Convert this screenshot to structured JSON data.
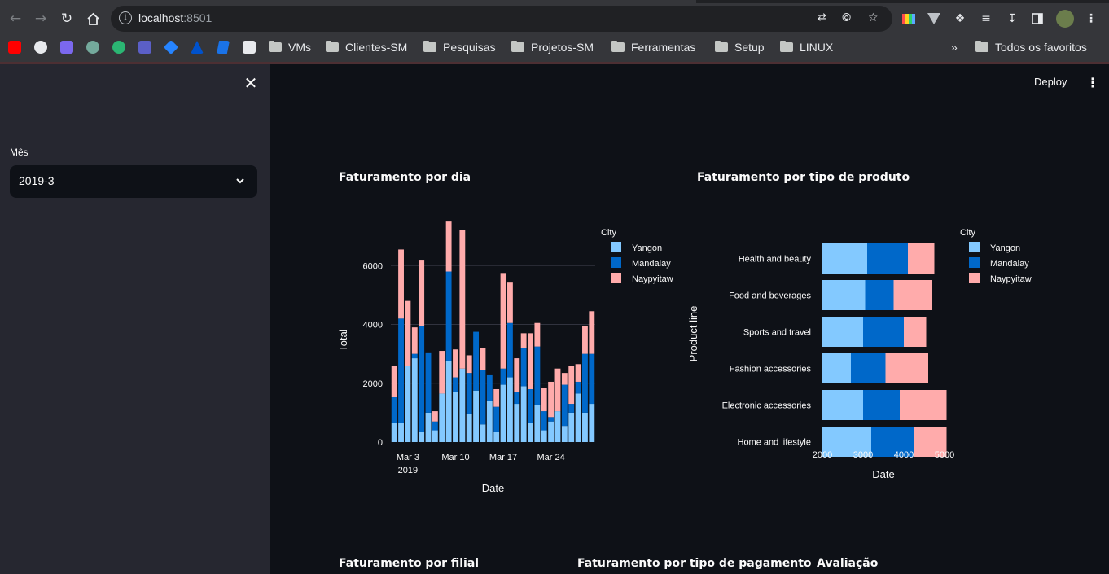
{
  "browser": {
    "url_host": "localhost",
    "url_port": ":8501",
    "bookmarks": [
      "VMs",
      "Clientes-SM",
      "Pesquisas",
      "Projetos-SM",
      "Ferramentas",
      "Setup",
      "LINUX"
    ],
    "all_bookmarks": "Todos os favoritos",
    "overflow": "»"
  },
  "sidebar": {
    "month_label": "Mês",
    "month_value": "2019-3"
  },
  "header": {
    "deploy": "Deploy",
    "menu_icon": "⋮"
  },
  "sections": {
    "daily": "Faturamento por dia",
    "product": "Faturamento por tipo de produto",
    "branch": "Faturamento por filial",
    "payment": "Faturamento por tipo de pagamento",
    "rating": "Avaliação"
  },
  "colors": {
    "yangon": "#83c9ff",
    "mandalay": "#0068c9",
    "naypyitaw": "#ffabab"
  },
  "chart_data": [
    {
      "type": "bar",
      "stacked": true,
      "xlabel": "Date",
      "ylabel": "Total",
      "ylim": [
        0,
        7500
      ],
      "yticks": [
        0,
        2000,
        4000,
        6000
      ],
      "xticks": [
        "Mar 3",
        "Mar 10",
        "Mar 17",
        "Mar 24"
      ],
      "xtick_year": "2019",
      "legend_title": "City",
      "categories": [
        "2019-03-01",
        "2019-03-02",
        "2019-03-03",
        "2019-03-04",
        "2019-03-05",
        "2019-03-06",
        "2019-03-07",
        "2019-03-08",
        "2019-03-09",
        "2019-03-10",
        "2019-03-11",
        "2019-03-12",
        "2019-03-13",
        "2019-03-14",
        "2019-03-15",
        "2019-03-16",
        "2019-03-17",
        "2019-03-18",
        "2019-03-19",
        "2019-03-20",
        "2019-03-21",
        "2019-03-22",
        "2019-03-23",
        "2019-03-24",
        "2019-03-25",
        "2019-03-26",
        "2019-03-27",
        "2019-03-28",
        "2019-03-29",
        "2019-03-30"
      ],
      "series": [
        {
          "name": "Yangon",
          "values": [
            650,
            650,
            2600,
            2850,
            350,
            1000,
            400,
            1650,
            2750,
            1700,
            2500,
            950,
            1750,
            600,
            1400,
            350,
            1950,
            2200,
            1300,
            1900,
            650,
            1250,
            400,
            700,
            1050,
            550,
            1000,
            1650,
            1000,
            1300
          ]
        },
        {
          "name": "Mandalay",
          "values": [
            900,
            3550,
            0,
            150,
            3600,
            2050,
            300,
            0,
            3050,
            500,
            0,
            1400,
            2000,
            1850,
            900,
            850,
            550,
            1850,
            400,
            1300,
            1150,
            2000,
            650,
            150,
            0,
            1400,
            300,
            400,
            2000,
            1700
          ]
        },
        {
          "name": "Naypyitaw",
          "values": [
            1050,
            2350,
            2200,
            900,
            2250,
            0,
            350,
            1450,
            1700,
            950,
            4700,
            600,
            0,
            750,
            0,
            600,
            3250,
            1400,
            1150,
            500,
            1900,
            800,
            800,
            1200,
            1450,
            400,
            1300,
            600,
            950,
            1450
          ]
        }
      ]
    },
    {
      "type": "bar",
      "orientation": "horizontal",
      "stacked": true,
      "xlabel": "Date",
      "ylabel": "Product line",
      "xlim": [
        2000,
        5000
      ],
      "xticks": [
        2000,
        3000,
        4000,
        5000
      ],
      "legend_title": "City",
      "categories": [
        "Health and beauty",
        "Food and beverages",
        "Sports and travel",
        "Fashion accessories",
        "Electronic accessories",
        "Home and lifestyle"
      ],
      "series": [
        {
          "name": "Yangon",
          "values": [
            1100,
            1050,
            1000,
            700,
            1000,
            1200
          ]
        },
        {
          "name": "Mandalay",
          "values": [
            1000,
            700,
            1000,
            850,
            900,
            1050
          ]
        },
        {
          "name": "Naypyitaw",
          "values": [
            650,
            950,
            550,
            1050,
            1150,
            800
          ]
        }
      ]
    }
  ]
}
